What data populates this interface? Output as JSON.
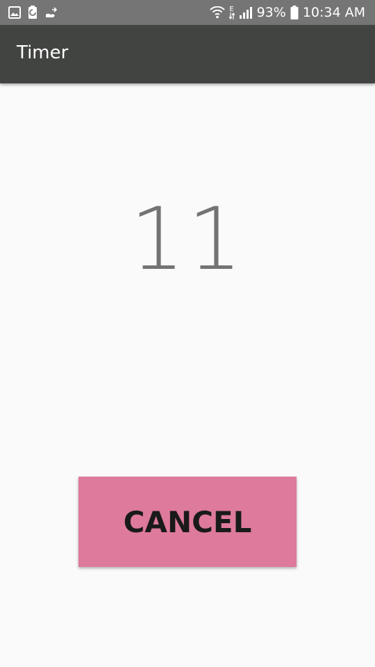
{
  "status_bar": {
    "battery_percent": "93%",
    "time": "10:34 AM",
    "network_type": "E",
    "left_icons": [
      "image-icon",
      "battery-saver-icon",
      "notification-icon"
    ],
    "right_icons": [
      "wifi-icon",
      "data-e-icon",
      "signal-icon",
      "battery-icon"
    ]
  },
  "app_bar": {
    "title": "Timer",
    "background": "#424441"
  },
  "timer": {
    "remaining": "11",
    "color": "#737373"
  },
  "cancel": {
    "label": "CANCEL",
    "background": "#de7a9b"
  }
}
